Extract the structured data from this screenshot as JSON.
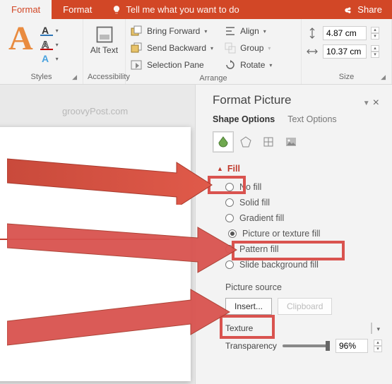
{
  "titlebar": {
    "tab1": "Format",
    "tab2": "Format",
    "search_placeholder": "Tell me what you want to do",
    "share": "Share"
  },
  "ribbon": {
    "styles_label": "Styles",
    "accessibility_label": "Accessibility",
    "alt_text": "Alt Text",
    "arrange_label": "Arrange",
    "bring_forward": "Bring Forward",
    "send_backward": "Send Backward",
    "selection_pane": "Selection Pane",
    "align": "Align",
    "group": "Group",
    "rotate": "Rotate",
    "size_label": "Size",
    "height": "4.87 cm",
    "width": "10.37 cm"
  },
  "canvas": {
    "watermark": "groovyPost.com"
  },
  "pane": {
    "title": "Format Picture",
    "tab_shape": "Shape Options",
    "tab_text": "Text Options",
    "fill_section": "Fill",
    "no_fill": "No fill",
    "solid_fill": "Solid fill",
    "gradient_fill": "Gradient fill",
    "picture_texture_fill": "Picture or texture fill",
    "pattern_fill": "Pattern fill",
    "slide_bg_fill": "Slide background fill",
    "picture_source": "Picture source",
    "insert": "Insert...",
    "clipboard": "Clipboard",
    "texture": "Texture",
    "transparency": "Transparency",
    "transparency_val": "96%"
  }
}
